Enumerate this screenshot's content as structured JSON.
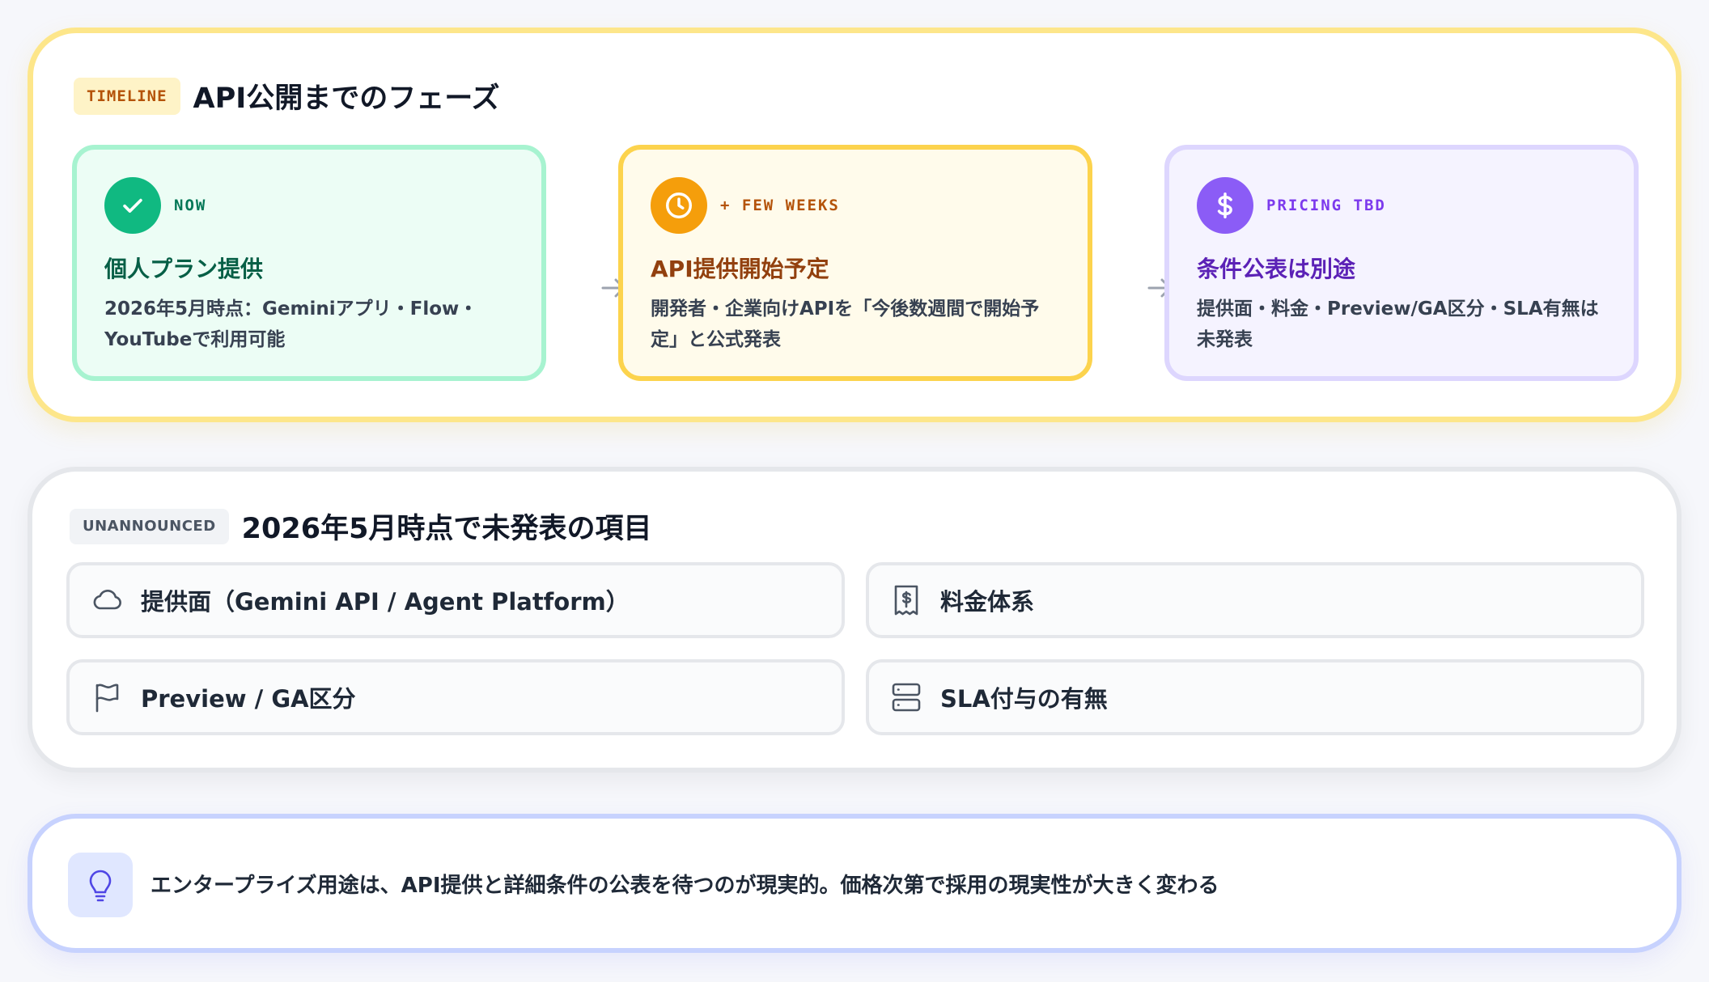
{
  "timeline": {
    "tag": "TIMELINE",
    "title": "API公開までのフェーズ",
    "phases": [
      {
        "label": "NOW",
        "title": "個人プラン提供",
        "desc_line1": "2026年5月時点：Geminiアプリ・Flow・",
        "desc_line2": "YouTubeで利用可能",
        "icon": "check-icon",
        "color": "#10b981"
      },
      {
        "label": "+ FEW WEEKS",
        "title": "API提供開始予定",
        "desc_line1": "開発者・企業向けAPIを「今後数週間で開始予",
        "desc_line2": "定」と公式発表",
        "icon": "clock-icon",
        "color": "#f59e0b"
      },
      {
        "label": "PRICING TBD",
        "title": "条件公表は別途",
        "desc_line1": "提供面・料金・Preview/GA区分・SLA有無は",
        "desc_line2": "未発表",
        "icon": "dollar-icon",
        "color": "#8b5cf6"
      }
    ]
  },
  "unannounced": {
    "tag": "UNANNOUNCED",
    "title": "2026年5月時点で未発表の項目",
    "items": [
      {
        "label": "提供面（Gemini API / Agent Platform）",
        "icon": "cloud-icon"
      },
      {
        "label": "料金体系",
        "icon": "receipt-icon"
      },
      {
        "label": "Preview / GA区分",
        "icon": "flag-icon"
      },
      {
        "label": "SLA付与の有無",
        "icon": "server-icon"
      }
    ]
  },
  "note": {
    "icon": "lightbulb-icon",
    "text": "エンタープライズ用途は、API提供と詳細条件の公表を待つのが現実的。価格次第で採用の現実性が大きく変わる"
  }
}
